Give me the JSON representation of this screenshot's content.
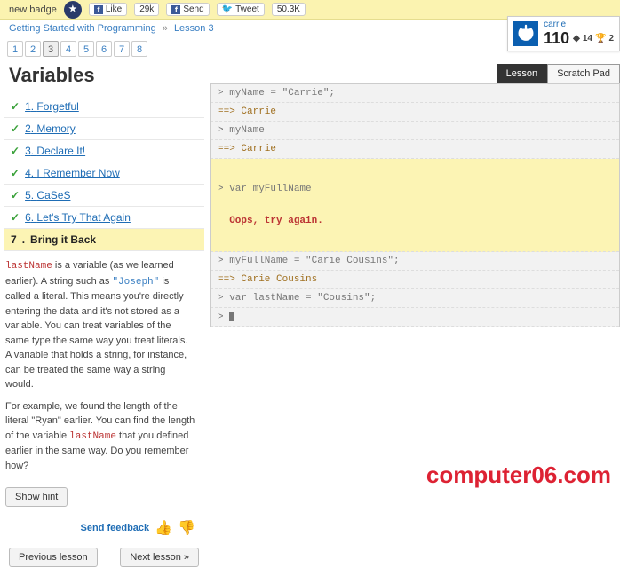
{
  "topbar": {
    "badge_text": "new badge",
    "like_label": "Like",
    "like_count": "29k",
    "send_label": "Send",
    "tweet_label": "Tweet",
    "tweet_count": "50.3K"
  },
  "breadcrumb": {
    "course": "Getting Started with Programming",
    "lesson": "Lesson 3"
  },
  "pager": [
    "1",
    "2",
    "3",
    "4",
    "5",
    "6",
    "7",
    "8"
  ],
  "pager_current": "3",
  "title": "Variables",
  "steps": [
    {
      "n": "1",
      "label": "Forgetful",
      "done": true
    },
    {
      "n": "2",
      "label": "Memory",
      "done": true
    },
    {
      "n": "3",
      "label": "Declare It!",
      "done": true
    },
    {
      "n": "4",
      "label": "I Remember Now",
      "done": true
    },
    {
      "n": "5",
      "label": "CaSeS",
      "done": true
    },
    {
      "n": "6",
      "label": "Let's Try That Again",
      "done": true
    },
    {
      "n": "7",
      "label": "Bring it Back",
      "active": true
    }
  ],
  "lesson": {
    "p1a": "lastName",
    "p1b": " is a variable (as we learned earlier). A string such as ",
    "p1c": "\"Joseph\"",
    "p1d": " is called a literal. This means you're directly entering the data and it's not stored as a variable. You can treat variables of the same type the same way you treat literals. A variable that holds a string, for instance, can be treated the same way a string would.",
    "p2a": "For example, we found the length of the literal \"Ryan\" earlier. You can find the length of the variable ",
    "p2b": "lastName",
    "p2c": " that you defined earlier in the same way. Do you remember how?"
  },
  "buttons": {
    "hint": "Show hint",
    "feedback": "Send feedback",
    "prev": "Previous lesson",
    "next": "Next lesson »"
  },
  "user": {
    "name": "carrie",
    "points": "110",
    "badge_count": "14",
    "trophy_count": "2"
  },
  "tabs": {
    "lesson": "Lesson",
    "scratch": "Scratch Pad"
  },
  "console": {
    "l1": "> myName = \"Carrie\";",
    "l2": "==> Carrie",
    "l3": "> myName",
    "l4": "==> Carrie",
    "l5": "> var myFullName",
    "err": "  Oops, try again.",
    "l6": "> myFullName = \"Carie Cousins\";",
    "l7": "==> Carie Cousins",
    "l8": "> var lastName = \"Cousins\";",
    "l9": "> "
  },
  "watermark": "computer06.com"
}
